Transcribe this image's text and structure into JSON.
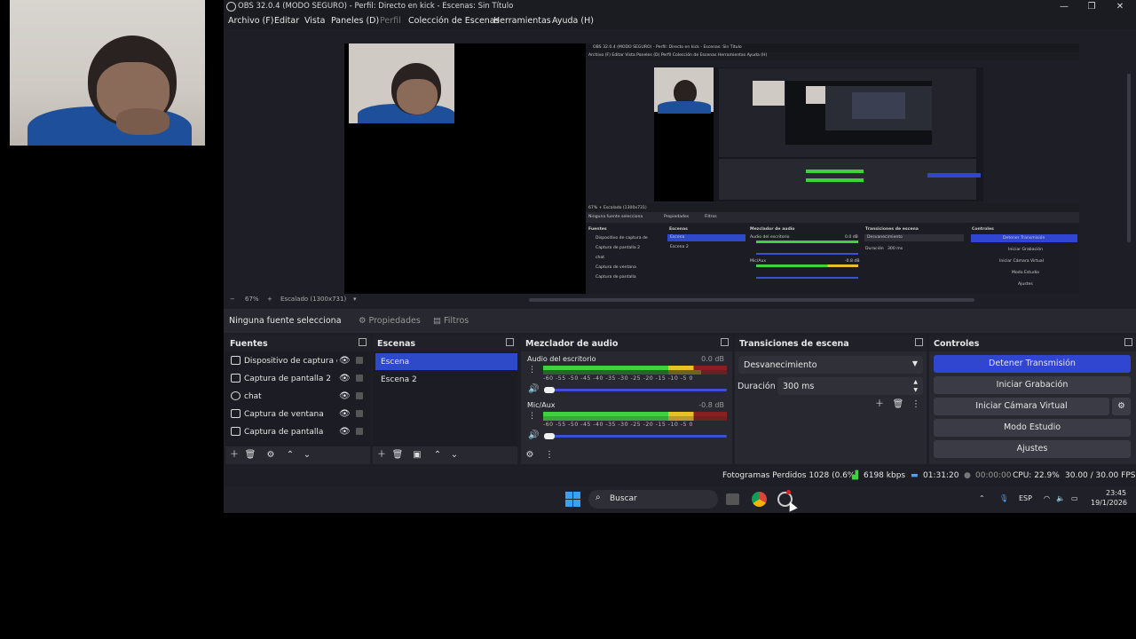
{
  "window": {
    "title": "OBS 32.0.4 (MODO SEGURO) - Perfil: Directo en kick - Escenas: Sin Título",
    "minimize": "—",
    "maximize": "❐",
    "close": "✕"
  },
  "menu": [
    "Archivo (F)",
    "Editar",
    "Vista",
    "Paneles (D)",
    "Perfil",
    "Colección de Escenas",
    "Herramientas",
    "Ayuda (H)"
  ],
  "zoom": {
    "minus": "−",
    "value": "67%",
    "plus": "+",
    "scaling": "Escalado (1300x731)"
  },
  "context": {
    "no_source": "Ninguna fuente selecciona",
    "properties": "Propiedades",
    "filters": "Filtros"
  },
  "docks": {
    "sources": {
      "title": "Fuentes",
      "items": [
        {
          "label": "Dispositivo de captura de",
          "icon": "camera-icon"
        },
        {
          "label": "Captura de pantalla 2",
          "icon": "monitor-icon"
        },
        {
          "label": "chat",
          "icon": "browser-icon"
        },
        {
          "label": "Captura de ventana",
          "icon": "window-icon"
        },
        {
          "label": "Captura de pantalla",
          "icon": "monitor-icon"
        }
      ]
    },
    "scenes": {
      "title": "Escenas",
      "items": [
        {
          "label": "Escena",
          "selected": true
        },
        {
          "label": "Escena 2",
          "selected": false
        }
      ]
    },
    "mixer": {
      "title": "Mezclador de audio",
      "ticks": "-60 -55 -50 -45 -40 -35 -30 -25 -20 -15 -10 -5 0",
      "channels": [
        {
          "name": "Audio del escritorio",
          "db": "0.0 dB",
          "level": 1.0
        },
        {
          "name": "Mic/Aux",
          "db": "-0.8 dB",
          "level": 0.95
        }
      ]
    },
    "transitions": {
      "title": "Transiciones de escena",
      "selected": "Desvanecimiento",
      "duration_label": "Duración",
      "duration_value": "300 ms"
    },
    "controls": {
      "title": "Controles",
      "stop_stream": "Detener Transmisión",
      "start_recording": "Iniciar Grabación",
      "virtual_cam": "Iniciar Cámara Virtual",
      "studio_mode": "Modo Estudio",
      "settings": "Ajustes"
    }
  },
  "status": {
    "dropped": "Fotogramas Perdidos 1028 (0.6%)",
    "bitrate": "6198 kbps",
    "stream_time": "01:31:20",
    "record_time": "00:00:00",
    "cpu": "CPU: 22.9%",
    "fps": "30.00 / 30.00 FPS"
  },
  "taskbar": {
    "search": "Buscar",
    "lang": "ESP",
    "time": "23:45",
    "date": "19/1/2026"
  },
  "nested": {
    "title": "OBS 32.0.4 (MODO SEGURO) - Perfil: Directo en kick - Escenas: Sin Título",
    "menu": "Archivo (F)   Editar   Vista   Paneles (D)   Perfil   Colección de Escenas   Herramientas   Ayuda (H)",
    "ctx": "Ninguna fuente selecciona",
    "props": "Propiedades",
    "filters": "Filtros",
    "zoom": "67%   +   Escalado (1300x731)",
    "sources_title": "Fuentes",
    "sources": [
      "Dispositivo de captura de",
      "Captura de pantalla 2",
      "chat",
      "Captura de ventana",
      "Captura de pantalla"
    ],
    "scenes_title": "Escenas",
    "scenes": [
      "Escena",
      "Escena 2"
    ],
    "mixer_title": "Mezclador de audio",
    "mixer_ch1": "Audio del escritorio",
    "mixer_ch1_db": "0.0 dB",
    "mixer_ch2": "Mic/Aux",
    "mixer_ch2_db": "-0.8 dB",
    "trans_title": "Transiciones de escena",
    "trans_sel": "Desvanecimiento",
    "trans_dur": "Duración",
    "trans_ms": "300 ms",
    "ctrl_title": "Controles",
    "ctrl": [
      "Detener Transmisión",
      "Iniciar Grabación",
      "Iniciar Cámara Virtual",
      "Modo Estudio",
      "Ajustes"
    ]
  },
  "colors": {
    "accent": "#3045d0",
    "panel": "#272830",
    "bg": "#1e1f26"
  }
}
